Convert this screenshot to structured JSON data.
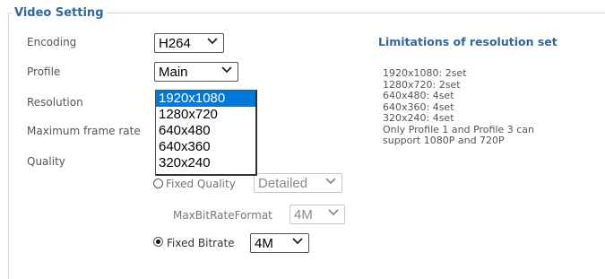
{
  "section": {
    "title": "Video Setting"
  },
  "form": {
    "encoding": {
      "label": "Encoding",
      "value": "H264"
    },
    "profile": {
      "label": "Profile",
      "value": "Main"
    },
    "resolution": {
      "label": "Resolution",
      "options": [
        "1920x1080",
        "1280x720",
        "640x480",
        "640x360",
        "320x240"
      ],
      "selected_index": 0
    },
    "max_frame_rate": {
      "label": "Maximum frame rate"
    },
    "quality": {
      "label": "Quality",
      "fixed_quality": {
        "label": "Fixed Quality",
        "value": "Detailed",
        "checked": false
      },
      "max_bitrate_format": {
        "label": "MaxBitRateFormat",
        "value": "4M"
      },
      "fixed_bitrate": {
        "label": "Fixed Bitrate",
        "value": "4M",
        "checked": true
      }
    }
  },
  "limitations": {
    "title": "Limitations of resolution set",
    "lines": [
      "1920x1080: 2set",
      "1280x720: 2set",
      "640x480: 4set",
      "640x360: 4set",
      "320x240: 4set",
      "Only Profile 1 and Profile 3 can",
      "support 1080P and 720P"
    ]
  },
  "colors": {
    "heading": "#336699",
    "selection": "#0078d7"
  }
}
